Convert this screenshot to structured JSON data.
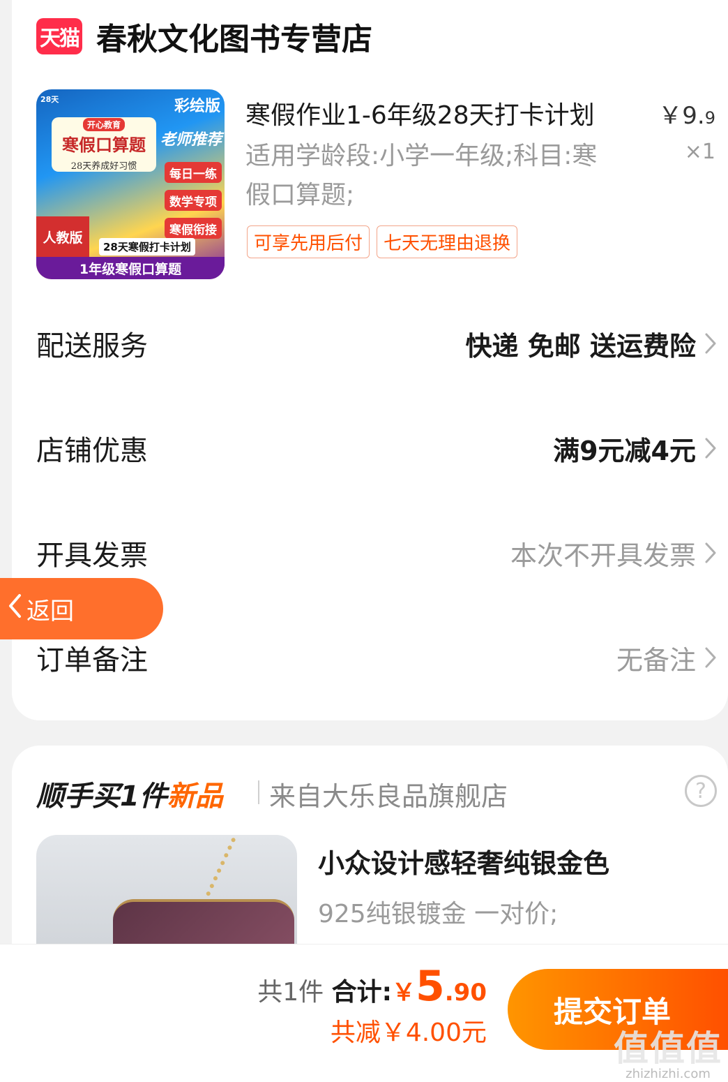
{
  "store": {
    "logo_text": "天猫",
    "name": "春秋文化图书专营店"
  },
  "product": {
    "image_text": {
      "brand": "开心教育",
      "title": "寒假口算题",
      "subtitle": "28天养成好习惯",
      "color_edition": "彩绘版",
      "recommend": "老师推荐",
      "tags": [
        "每日一练",
        "数学专项",
        "寒假衔接"
      ],
      "edition": "人教版",
      "plan": "28天寒假打卡计划",
      "grade_title": "1年级寒假口算题"
    },
    "title": "寒假作业1-6年级28天打卡计划",
    "price_main": "￥9.",
    "price_decimal": "9",
    "spec": "适用学龄段:小学一年级;科目:寒假口算题;",
    "quantity": "×1",
    "tags": [
      "可享先用后付",
      "七天无理由退换"
    ]
  },
  "rows": {
    "delivery": {
      "label": "配送服务",
      "value": "快递 免邮 送运费险"
    },
    "discount": {
      "label": "店铺优惠",
      "value": "满9元减4元"
    },
    "invoice": {
      "label": "开具发票",
      "value": "本次不开具发票"
    },
    "remark": {
      "label": "订单备注",
      "value": "无备注"
    }
  },
  "back_button": {
    "label": "返回"
  },
  "addon": {
    "title_prefix": "顺手买1件",
    "title_new": "新品",
    "source": "来自大乐良品旗舰店",
    "help": "?",
    "item_name": "小众设计感轻奢纯银金色",
    "item_desc": "925纯银镀金 一对价;"
  },
  "summary": {
    "count": "共1件",
    "total_label": "合计:",
    "currency": "￥",
    "total_int": "5",
    "total_dec": ".90",
    "saved": "共减￥4.00元"
  },
  "submit": {
    "label": "提交订单"
  },
  "watermark": {
    "logo": "值值值",
    "url": "zhizhizhi.com"
  },
  "colors": {
    "accent": "#ff5000",
    "tmall": "#ff2d4a",
    "back": "#ff6f2c"
  }
}
